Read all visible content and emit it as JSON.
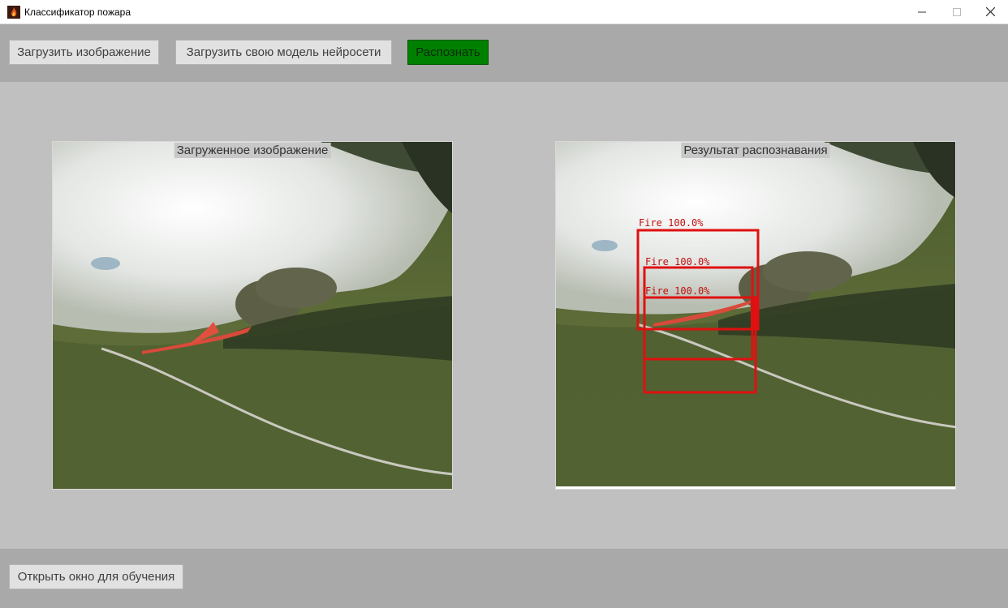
{
  "window": {
    "title": "Классификатор пожара",
    "controls": {
      "minimize": "—",
      "maximize": "☐",
      "close": "✕"
    }
  },
  "toolbar": {
    "load_image": "Загрузить изображение",
    "load_model": "Загрузить свою модель нейросети",
    "recognize": "Распознать"
  },
  "panels": {
    "loaded_label": "Загруженное изображение",
    "result_label": "Результат распознавания"
  },
  "detections": [
    {
      "label": "Fire",
      "confidence": "100.0%"
    },
    {
      "label": "Fire",
      "confidence": "100.0%"
    },
    {
      "label": "Fire",
      "confidence": "100.0%"
    }
  ],
  "footer": {
    "open_training": "Открыть окно для обучения"
  },
  "colors": {
    "toolbar_bg": "#a9a9a9",
    "body_bg": "#c0c0c0",
    "recognize_button": "#008000",
    "detection_box": "#e01010"
  }
}
